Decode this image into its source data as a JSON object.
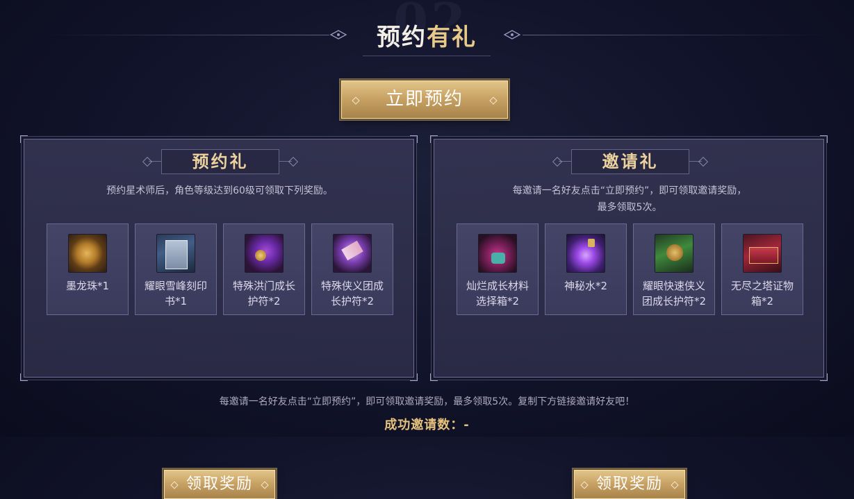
{
  "section": {
    "bg_number": "02",
    "title_part1": "预约",
    "title_part2": "有礼",
    "reserve_button": "立即预约"
  },
  "panels": {
    "reserve": {
      "title": "预约礼",
      "desc_line1": "预约星术师后，角色等级达到60级可领取下列奖励。",
      "items": [
        {
          "icon": "dragon-pearl-icon",
          "name_line1": "墨龙珠*1",
          "name_line2": ""
        },
        {
          "icon": "engraving-book-icon",
          "name_line1": "耀眼雪峰刻印",
          "name_line2": "书*1"
        },
        {
          "icon": "hongmen-amulet-icon",
          "name_line1": "特殊洪门成长",
          "name_line2": "护符*2"
        },
        {
          "icon": "chivalry-amulet-icon",
          "name_line1": "特殊侠义团成",
          "name_line2": "长护符*2"
        }
      ],
      "claim_button": "领取奖励"
    },
    "invite": {
      "title": "邀请礼",
      "desc_line1": "每邀请一名好友点击“立即预约”，即可领取邀请奖励，",
      "desc_line2": "最多领取5次。",
      "items": [
        {
          "icon": "material-bag-icon",
          "name_line1": "灿烂成长材料",
          "name_line2": "选择箱*2"
        },
        {
          "icon": "mystic-potion-icon",
          "name_line1": "神秘水*2",
          "name_line2": ""
        },
        {
          "icon": "fast-chivalry-amulet-icon",
          "name_line1": "耀眼快速侠义",
          "name_line2": "团成长护符*2"
        },
        {
          "icon": "endless-tower-chest-icon",
          "name_line1": "无尽之塔证物",
          "name_line2": "箱*2"
        }
      ],
      "claim_button": "领取奖励"
    }
  },
  "footer": {
    "note": "每邀请一名好友点击“立即预约”，即可领取邀请奖励，最多领取5次。复制下方链接邀请好友吧！",
    "success_label": "成功邀请数：-"
  },
  "colors": {
    "gold": "#e7c98a",
    "panel_bg": "#343452",
    "page_bg": "#11132a"
  }
}
